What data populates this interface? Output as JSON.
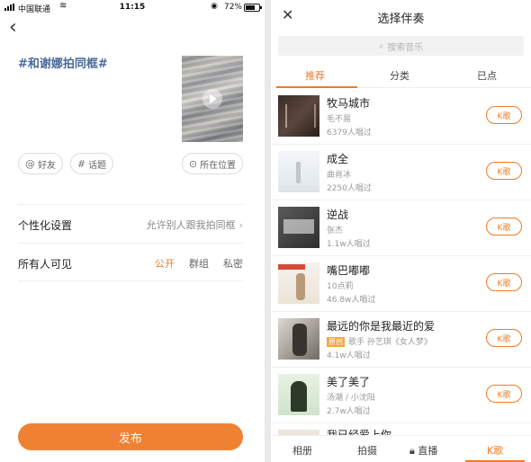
{
  "left": {
    "status_bar": {
      "carrier": "中国联通",
      "time": "11:15",
      "battery": "72%",
      "battery_level": 0.72
    },
    "hashtag": "#和谢娜拍同框#",
    "chips": {
      "friend": "好友",
      "topic": "话题",
      "location": "所在位置"
    },
    "settings": {
      "personalize_label": "个性化设置",
      "personalize_value": "允许别人跟我拍同框",
      "visibility_label": "所有人可见",
      "visibility_options": [
        "公开",
        "群组",
        "私密"
      ]
    },
    "publish_label": "发布"
  },
  "right": {
    "title": "选择伴奏",
    "search_placeholder": "搜索音乐",
    "tabs": [
      "推荐",
      "分类",
      "已点"
    ],
    "k_label": "K歌",
    "songs": [
      {
        "title": "牧马城市",
        "artist": "毛不易",
        "count": "6379人唱过"
      },
      {
        "title": "成全",
        "artist": "曲肖冰",
        "count": "2250人唱过"
      },
      {
        "title": "逆战",
        "artist": "张杰",
        "count": "1.1w人唱过"
      },
      {
        "title": "嘴巴嘟嘟",
        "artist": "10点莉",
        "count": "46.8w人唱过"
      },
      {
        "title": "最远的你是我最近的爱",
        "badge": "原创",
        "artist": "歌手 孙艺琪《女人梦》",
        "count": "4.1w人唱过"
      },
      {
        "title": "美了美了",
        "artist": "汤潮 / 小沈阳",
        "count": "2.7w人唱过"
      }
    ],
    "partial_song_title": "我已经爱上你",
    "bottom_nav": [
      "相册",
      "拍摄",
      "直播",
      "K歌"
    ]
  },
  "colors": {
    "accent": "#ee7b26",
    "hashtag": "#4a6a9a"
  },
  "icons": [
    "signal-icon",
    "wifi-icon",
    "lock-rotation-icon",
    "battery-icon",
    "back-arrow-icon",
    "play-icon",
    "at-icon",
    "hash-icon",
    "location-pin-icon",
    "chevron-right-icon",
    "close-icon",
    "search-icon",
    "lock-icon"
  ]
}
